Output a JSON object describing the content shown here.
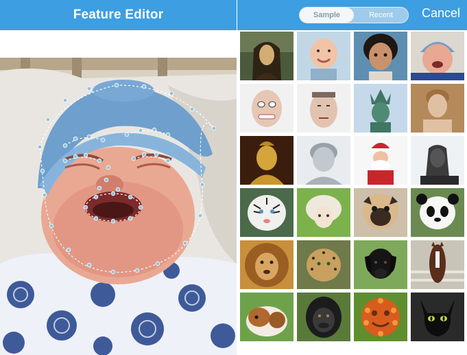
{
  "editor": {
    "title": "Feature Editor",
    "accent": "#3d9ee2",
    "landmark_color": "#8fc4dc"
  },
  "picker": {
    "segments": [
      {
        "label": "Sample",
        "selected": true
      },
      {
        "label": "Recent",
        "selected": false
      }
    ],
    "cancel_label": "Cancel",
    "rows": [
      [
        "mona-lisa",
        "baby-smiling",
        "toddler-curly-hair",
        "baby-crying"
      ],
      [
        "man-face-stretched",
        "man-face-squished",
        "statue-of-liberty",
        "statue-of-david"
      ],
      [
        "golden-buddha",
        "cherub-statue",
        "santa-claus",
        "sphinx"
      ],
      [
        "white-tiger",
        "sheep",
        "pug",
        "panda"
      ],
      [
        "lion",
        "leopard",
        "black-labrador",
        "horse"
      ],
      [
        "guinea-pig",
        "gorilla",
        "fruit-face",
        "black-cat"
      ]
    ]
  }
}
